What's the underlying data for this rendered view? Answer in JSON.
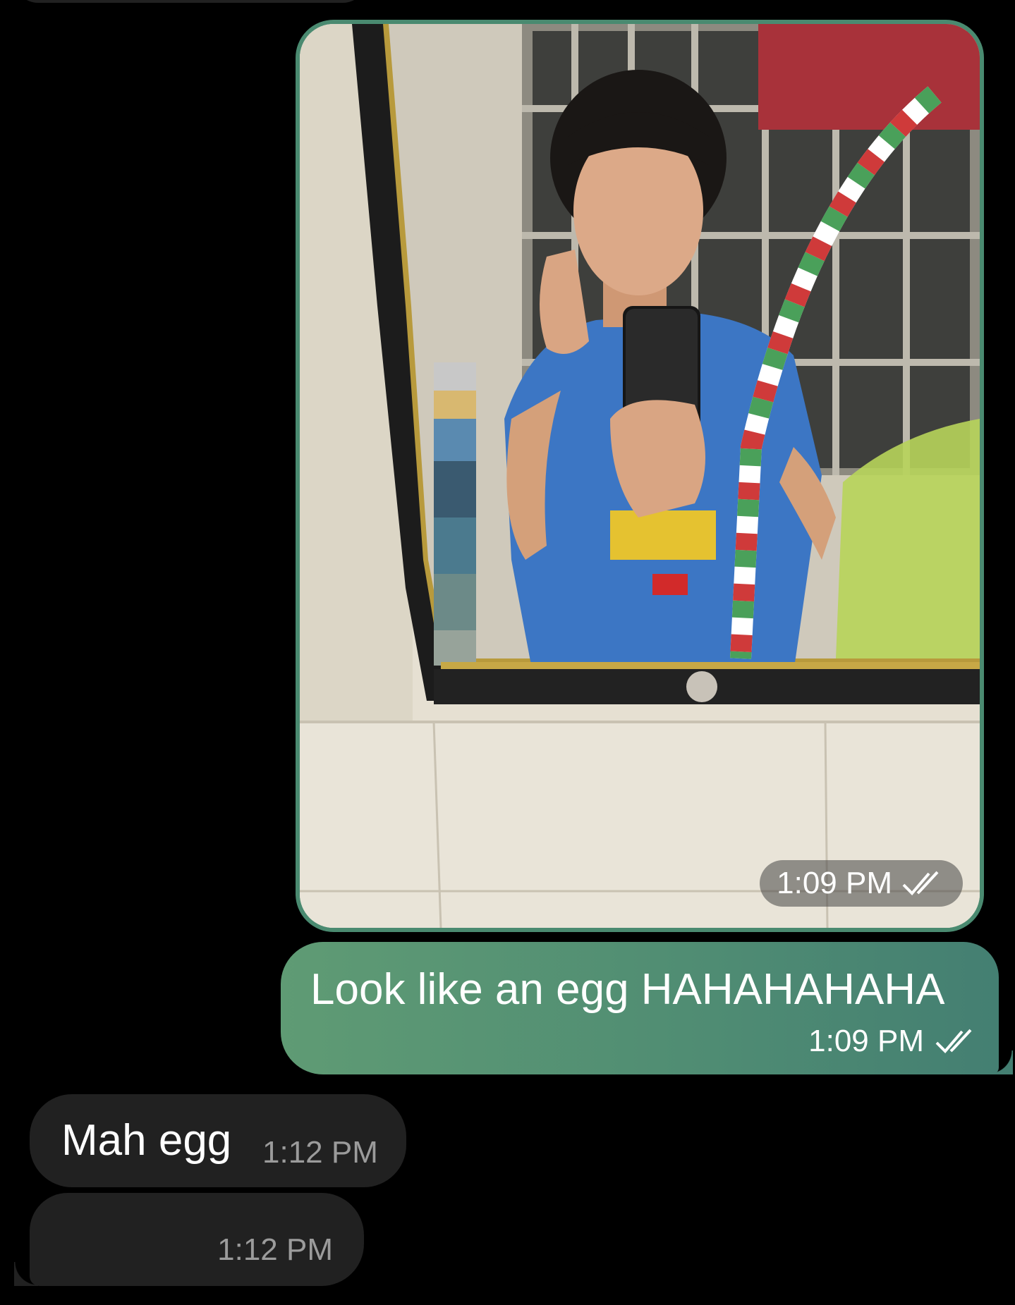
{
  "messages": [
    {
      "direction": "outgoing",
      "type": "photo",
      "time": "1:09 PM",
      "status_icon": "double-check-icon"
    },
    {
      "direction": "outgoing",
      "type": "text",
      "text": "Look like an egg HAHAHAHAHA",
      "time": "1:09 PM",
      "status_icon": "double-check-icon"
    },
    {
      "direction": "incoming",
      "type": "text",
      "text": "Mah egg",
      "time": "1:12 PM"
    },
    {
      "direction": "incoming",
      "type": "text",
      "text": "",
      "time": "1:12 PM"
    }
  ],
  "colors": {
    "background": "#000000",
    "outgoing_bubble": "#5f9b74",
    "incoming_bubble": "#212121",
    "timestamp_incoming": "#9b9b9b"
  }
}
